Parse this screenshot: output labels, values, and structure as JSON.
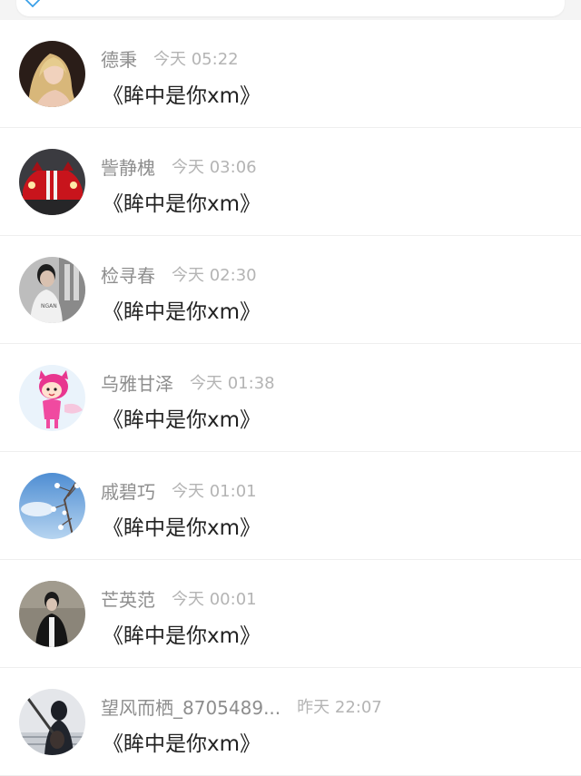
{
  "search": {
    "icon": "back-arrow-icon"
  },
  "comments": [
    {
      "name": "德秉",
      "time": "今天 05:22",
      "message": "《眸中是你xm》",
      "avatar": "blonde-woman"
    },
    {
      "name": "訾静槐",
      "time": "今天 03:06",
      "message": "《眸中是你xm》",
      "avatar": "red-sports-car"
    },
    {
      "name": "检寻春",
      "time": "今天 02:30",
      "message": "《眸中是你xm》",
      "avatar": "young-man-photo"
    },
    {
      "name": "乌雅甘泽",
      "time": "今天 01:38",
      "message": "《眸中是你xm》",
      "avatar": "cartoon-girl-pink"
    },
    {
      "name": "戚碧巧",
      "time": "今天 01:01",
      "message": "《眸中是你xm》",
      "avatar": "sky-and-branches"
    },
    {
      "name": "芒英范",
      "time": "今天 00:01",
      "message": "《眸中是你xm》",
      "avatar": "man-dark-coat"
    },
    {
      "name": "望风而栖_8705489...",
      "time": "昨天 22:07",
      "message": "《眸中是你xm》",
      "avatar": "figure-with-guitar"
    }
  ],
  "colors": {
    "name": "#8e8e8e",
    "time": "#b4b4b4",
    "message": "#222222",
    "divider": "#eeeeee"
  }
}
